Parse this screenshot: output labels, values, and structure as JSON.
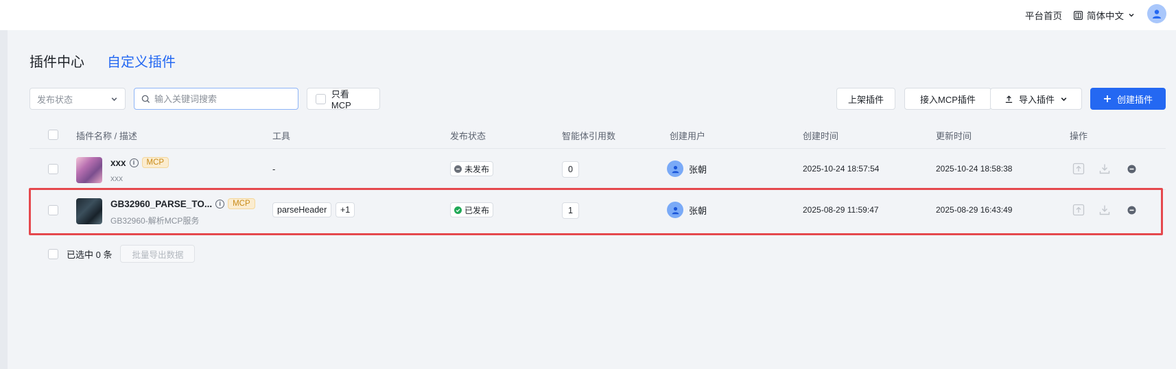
{
  "header": {
    "home_link": "平台首页",
    "language": "简体中文"
  },
  "tabs": [
    {
      "label": "插件中心",
      "active": false
    },
    {
      "label": "自定义插件",
      "active": true
    }
  ],
  "toolbar": {
    "status_select": "发布状态",
    "search_placeholder": "输入关键词搜索",
    "mcp_only_label": "只看 MCP",
    "shelf_button": "上架插件",
    "connect_mcp_button": "接入MCP插件",
    "import_button": "导入插件",
    "create_button": "创建插件"
  },
  "table": {
    "columns": [
      "插件名称 / 描述",
      "工具",
      "发布状态",
      "智能体引用数",
      "创建用户",
      "创建时间",
      "更新时间",
      "操作"
    ],
    "rows": [
      {
        "name": "xxx",
        "tag": "MCP",
        "description": "xxx",
        "tools": [
          "-"
        ],
        "status": "未发布",
        "status_color": "#6b7079",
        "ref_count": "0",
        "user": "张朝",
        "created": "2025-10-24 18:57:54",
        "updated": "2025-10-24 18:58:38"
      },
      {
        "name": "GB32960_PARSE_TO...",
        "tag": "MCP",
        "description": "GB32960-解析MCP服务",
        "tools": [
          "parseHeader",
          "+1"
        ],
        "status": "已发布",
        "status_color": "#21a957",
        "ref_count": "1",
        "user": "张朝",
        "created": "2025-08-29 11:59:47",
        "updated": "2025-08-29 16:43:49"
      }
    ]
  },
  "footer": {
    "selected_text": "已选中 0 条",
    "export_button": "批量导出数据"
  },
  "colors": {
    "primary": "#2468f2",
    "highlight": "#e5484d",
    "mcp_tag_bg": "#fbeccf",
    "mcp_tag_text": "#c88a18"
  },
  "icons": {
    "user_avatar": "person-icon",
    "language": "translate-icon",
    "search": "search-icon",
    "upload": "upload-icon",
    "download": "download-icon",
    "remove": "minus-circle-icon",
    "info": "info-icon"
  }
}
